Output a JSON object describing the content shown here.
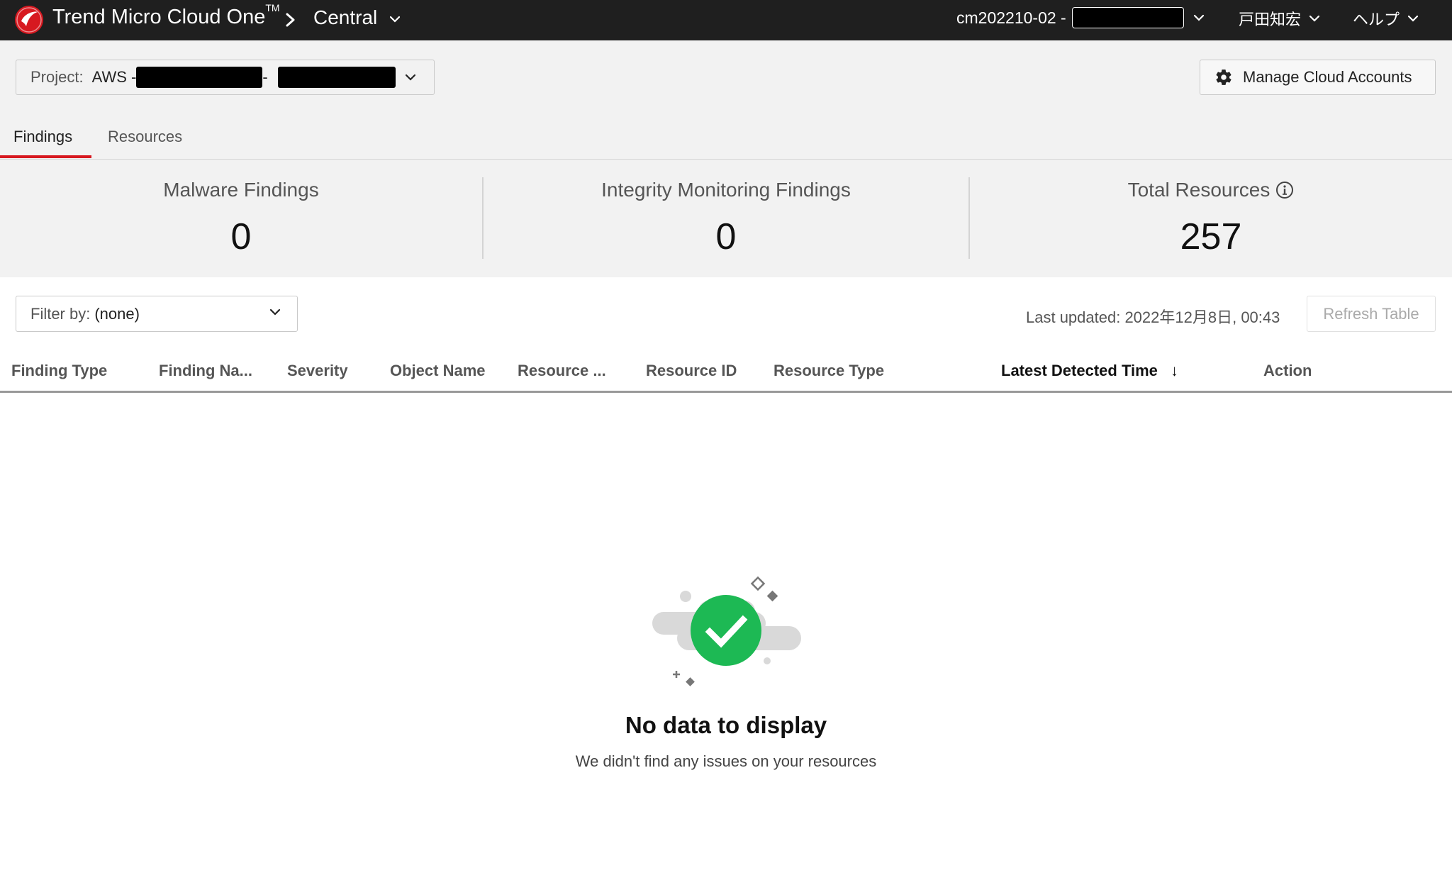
{
  "topbar": {
    "brand": "Trend Micro Cloud One",
    "brand_tm": "TM",
    "service": "Central",
    "account": "cm202210-02 -",
    "user": "戸田知宏",
    "help": "ヘルプ"
  },
  "project": {
    "label": "Project:",
    "value_prefix": "AWS -",
    "value_sep": "-"
  },
  "manage_button": "Manage Cloud Accounts",
  "tabs": [
    {
      "label": "Findings",
      "active": true
    },
    {
      "label": "Resources",
      "active": false
    }
  ],
  "stats": [
    {
      "title": "Malware Findings",
      "value": "0"
    },
    {
      "title": "Integrity Monitoring Findings",
      "value": "0"
    },
    {
      "title": "Total Resources",
      "value": "257"
    }
  ],
  "filter": {
    "label": "Filter by:",
    "value": "(none)"
  },
  "last_updated": "Last updated: 2022年12月8日, 00:43",
  "refresh_button": "Refresh Table",
  "table": {
    "columns": [
      "Finding Type",
      "Finding Na...",
      "Severity",
      "Object Name",
      "Resource ...",
      "Resource ID",
      "Resource Type",
      "Latest Detected Time",
      "Action"
    ],
    "sorted_column": "Latest Detected Time",
    "sort_indicator": "↓"
  },
  "empty_state": {
    "title": "No data to display",
    "subtitle": "We didn't find any issues on your resources"
  },
  "colors": {
    "topbar_bg": "#1f1f1f",
    "brand_red": "#d71920",
    "success_green": "#1db954",
    "header_bg": "#f2f2f2"
  }
}
